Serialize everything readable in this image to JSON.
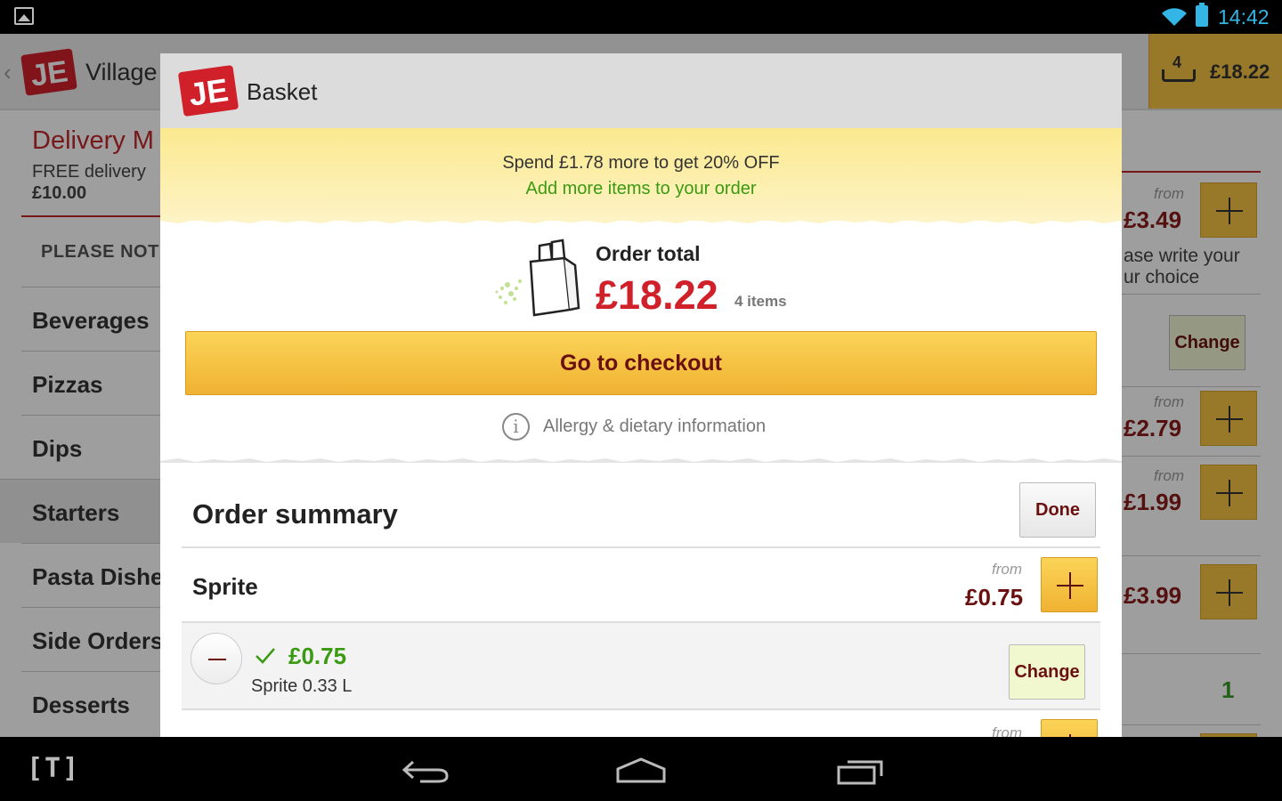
{
  "status_bar": {
    "time": "14:42",
    "icons": [
      "gallery-notification-icon",
      "wifi-icon",
      "battery-icon"
    ]
  },
  "background_app": {
    "restaurant_title": "Village",
    "basket_count": "4",
    "basket_total": "£18.22",
    "delivery_title": "Delivery M",
    "delivery_sub": "FREE delivery",
    "delivery_min": "£10.00",
    "note_label": "PLEASE NOTE:",
    "categories": [
      "Beverages",
      "Pizzas",
      "Dips",
      "Starters",
      "Pasta Dishe",
      "Side Orders",
      "Desserts"
    ],
    "active_category": "Starters",
    "menu_prices": [
      {
        "from": "from",
        "value": "£3.49"
      },
      {
        "from": "from",
        "value": "£2.79"
      },
      {
        "from": "from",
        "value": "£1.99"
      },
      {
        "from": "",
        "value": "£3.99"
      }
    ],
    "note_text_line1": "ase write your",
    "note_text_line2": "ur choice",
    "change_label": "Change",
    "quantity": "1"
  },
  "dialog": {
    "title": "Basket",
    "promo_line1": "Spend £1.78 more to get 20% OFF",
    "promo_line2": "Add more items to your order",
    "order_total_label": "Order total",
    "order_total_value": "£18.22",
    "order_items": "4 items",
    "checkout_label": "Go to checkout",
    "allergy_label": "Allergy & dietary information",
    "summary_title": "Order summary",
    "done_label": "Done",
    "items": [
      {
        "name": "Sprite",
        "from": "from",
        "price": "£0.75",
        "selection_price": "£0.75",
        "selection_desc": "Sprite 0.33 L",
        "change_label": "Change"
      },
      {
        "name": "",
        "from": "from",
        "price": ""
      }
    ]
  },
  "nav_bar": {
    "icons": [
      "tapatalk-icon",
      "back-icon",
      "home-icon",
      "recent-apps-icon"
    ],
    "t_label": "[T]"
  },
  "colors": {
    "brand_red": "#d0202a",
    "accent_yellow": "#f5c243",
    "promo_bg": "#fbe98f",
    "green": "#3a9a12",
    "dark_red_text": "#6b1010"
  }
}
